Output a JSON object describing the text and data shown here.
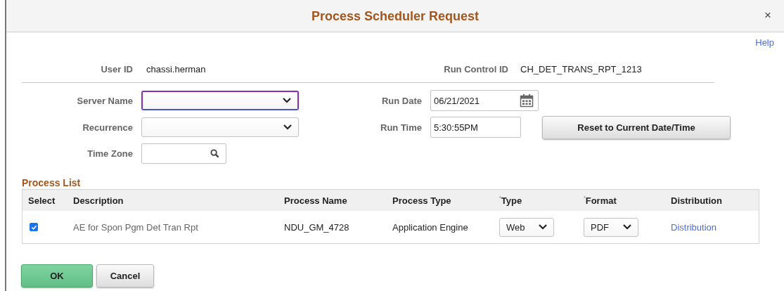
{
  "window": {
    "title": "Process Scheduler Request",
    "close": "×"
  },
  "help_link": "Help",
  "user_id": {
    "label": "User ID",
    "value": "chassi.herman"
  },
  "run_control_id": {
    "label": "Run Control ID",
    "value": "CH_DET_TRANS_RPT_1213"
  },
  "server_name": {
    "label": "Server Name",
    "focused": true
  },
  "recurrence": {
    "label": "Recurrence"
  },
  "time_zone": {
    "label": "Time Zone"
  },
  "run_date": {
    "label": "Run Date",
    "value": "06/21/2021"
  },
  "run_time": {
    "label": "Run Time",
    "value": "5:30:55PM"
  },
  "reset_button": "Reset to Current Date/Time",
  "process_list": {
    "title": "Process List",
    "columns": [
      {
        "label": "Select"
      },
      {
        "label": "Description"
      },
      {
        "label": "Process Name"
      },
      {
        "label": "Process Type"
      },
      {
        "label": "Type",
        "required_mark": "*"
      },
      {
        "label": "Format",
        "required_mark": "*"
      },
      {
        "label": "Distribution"
      }
    ],
    "rows": [
      {
        "selected": true,
        "description": "AE for Spon Pgm Det Tran Rpt",
        "process_name": "NDU_GM_4728",
        "process_type": "Application Engine",
        "type": "Web",
        "format": "PDF",
        "distribution": "Distribution"
      }
    ]
  },
  "buttons": [
    {
      "label": "OK",
      "kind": "primary"
    },
    {
      "label": "Cancel",
      "kind": "secondary"
    }
  ]
}
